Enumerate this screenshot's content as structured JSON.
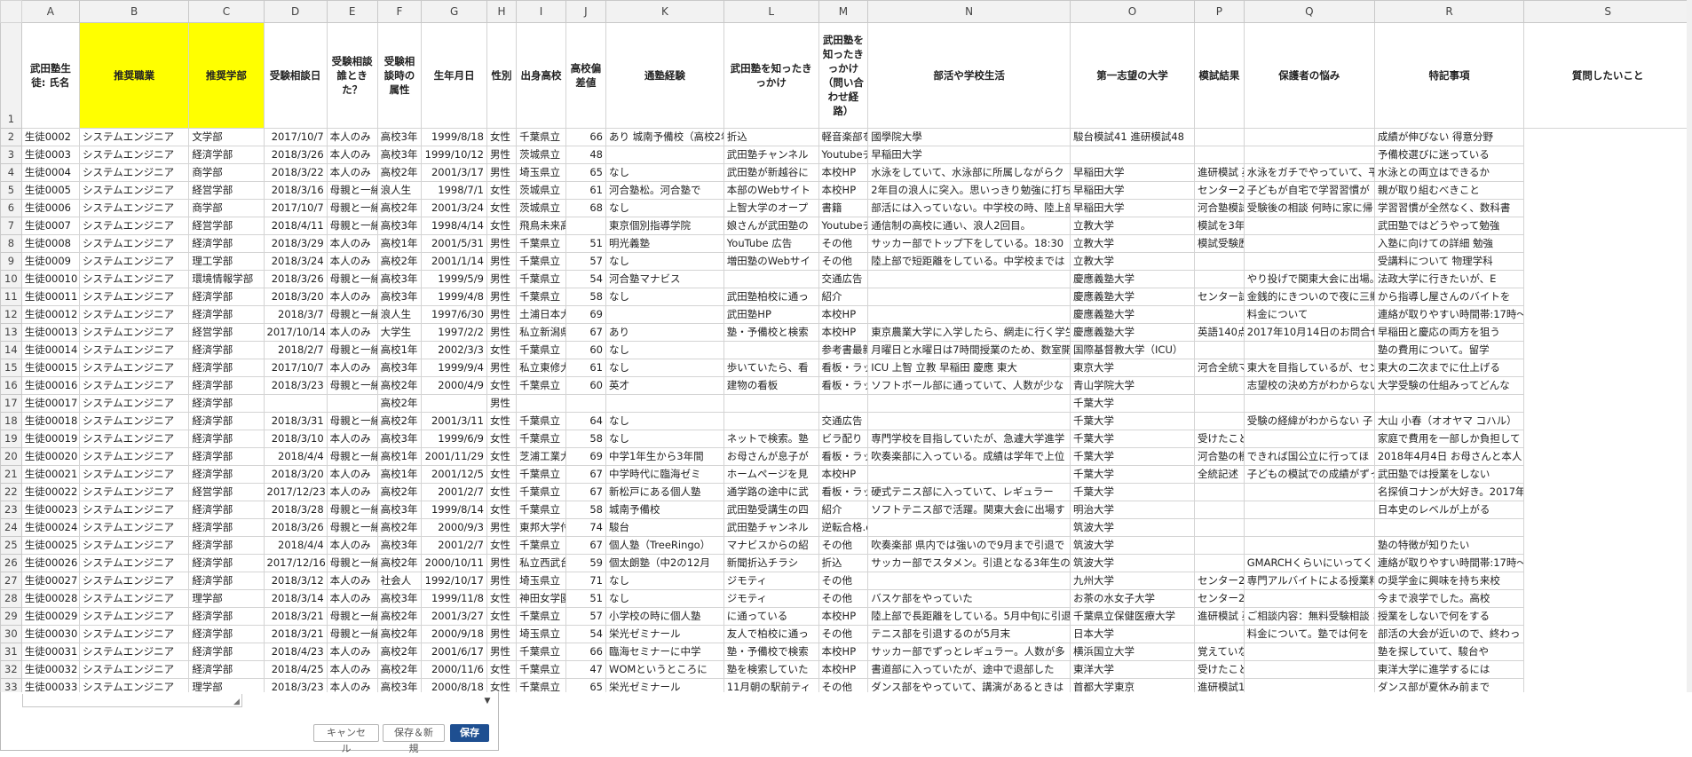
{
  "columns": [
    "A",
    "B",
    "C",
    "D",
    "E",
    "F",
    "G",
    "H",
    "I",
    "J",
    "K",
    "L",
    "M",
    "N",
    "O",
    "P",
    "Q",
    "R",
    "S"
  ],
  "header_row_number": "1",
  "headers": [
    "武田塾生徒: 氏名",
    "推奨職業",
    "推奨学部",
    "受験相談日",
    "受験相談誰ときた？",
    "受験相談時の属性",
    "生年月日",
    "性別",
    "出身高校",
    "高校偏差値",
    "通塾経験",
    "武田塾を知ったきっかけ",
    "武田塾を知ったきっかけ（問い合わせ経路）",
    "部活や学校生活",
    "第一志望の大学",
    "模試結果",
    "保護者の悩み",
    "特記事項",
    "質問したいこと"
  ],
  "rows": [
    [
      "2",
      "生徒0002",
      "システムエンジニア",
      "文学部",
      "2017/10/7",
      "本人のみ",
      "高校3年",
      "1999/8/18",
      "女性",
      "千葉県立",
      "66",
      "あり 城南予備校（高校2年夏から。集団",
      "折込",
      "軽音楽部をやっていて、ドラムをしている",
      "國學院大學",
      "駿台模試41 進研模試48",
      "",
      "",
      "成績が伸びない 得意分野"
    ],
    [
      "3",
      "生徒0003",
      "システムエンジニア",
      "経済学部",
      "2018/3/26",
      "本人のみ",
      "高校3年",
      "1999/10/12",
      "男性",
      "茨城県立",
      "48",
      "",
      "武田塾チャンネル",
      "Youtubeチャンネル",
      "早稲田大学",
      "",
      "",
      "",
      "予備校選びに迷っている"
    ],
    [
      "4",
      "生徒0004",
      "システムエンジニア",
      "商学部",
      "2018/3/22",
      "本人のみ",
      "高校2年",
      "2001/3/17",
      "男性",
      "埼玉県立",
      "65",
      "なし",
      "武田塾が新越谷に",
      "本校HP",
      "水泳をしていて、水泳部に所属しながらク",
      "早稲田大学",
      "進研模試 英語56 数学50 国語48 日本史",
      "水泳をガチでやっていて、平日",
      "水泳との両立はできるか"
    ],
    [
      "5",
      "生徒0005",
      "システムエンジニア",
      "経営学部",
      "2018/3/16",
      "母親と一緒",
      "浪人生",
      "1998/7/1",
      "女性",
      "茨城県立",
      "61",
      "河合塾松。河合塾で",
      "本部のWebサイト",
      "本校HP",
      "2年目の浪人に突入。思いっきり勉強に打ち",
      "早稲田大学",
      "センター2",
      "子どもが自宅で学習習慣が",
      "親が取り組むべきこと"
    ],
    [
      "6",
      "生徒0006",
      "システムエンジニア",
      "商学部",
      "2017/10/7",
      "母親と一緒",
      "高校2年",
      "2001/3/24",
      "女性",
      "茨城県立",
      "68",
      "なし",
      "上智大学のオープ",
      "書籍",
      "部活には入っていない。中学校の時、陸上部",
      "早稲田大学",
      "河合塾模試",
      "受験後の相談 何時に家に帰",
      "学習習慣が全然なく、数科書"
    ],
    [
      "7",
      "生徒0007",
      "システムエンジニア",
      "経営学部",
      "2018/4/11",
      "母親と一緒",
      "高校3年",
      "1998/4/14",
      "女性",
      "飛鳥未来高等学校",
      "",
      "東京個別指導学院",
      "娘さんが武田塾の",
      "Youtubeチャンネル",
      "通信制の高校に通い、浪人2回目。",
      "立教大学",
      "模試を3年間受けていない",
      "",
      "武田塾ではどうやって勉強"
    ],
    [
      "8",
      "生徒0008",
      "システムエンジニア",
      "経済学部",
      "2018/3/29",
      "本人のみ",
      "高校1年",
      "2001/5/31",
      "男性",
      "千葉県立",
      "51",
      "明光義塾",
      "YouTube 広告",
      "その他",
      "サッカー部でトップ下をしている。18:30",
      "立教大学",
      "模試受験歴なし",
      "",
      "入塾に向けての詳細 勉強"
    ],
    [
      "9",
      "生徒0009",
      "システムエンジニア",
      "理工学部",
      "2018/3/24",
      "本人のみ",
      "高校2年",
      "2001/1/14",
      "男性",
      "千葉県立",
      "57",
      "なし",
      "増田塾のWebサイ",
      "その他",
      "陸上部で短距離をしている。中学校までは",
      "立教大学",
      "",
      "",
      "受講料について 物理学科"
    ],
    [
      "10",
      "生徒00010",
      "システムエンジニア",
      "環境情報学部",
      "2018/3/26",
      "母親と一緒",
      "高校3年",
      "1999/5/9",
      "男性",
      "千葉県立",
      "54",
      "河合塾マナビス",
      "",
      "交通広告（駅看板・中吊り等）",
      "",
      "慶應義塾大学",
      "",
      "やり投げで関東大会に出場。大",
      "法政大学に行きたいが、E"
    ],
    [
      "11",
      "生徒00011",
      "システムエンジニア",
      "経済学部",
      "2018/3/20",
      "本人のみ",
      "高校3年",
      "1999/4/8",
      "男性",
      "千葉県立",
      "58",
      "なし",
      "武田塾柏校に通っ",
      "紹介",
      "",
      "慶應義塾大学",
      "センター試験2018 英語140 現代文64",
      "金銭的にきついので夜に三郷で",
      "から指導し屋さんのバイトを"
    ],
    [
      "12",
      "生徒00012",
      "システムエンジニア",
      "経済学部",
      "2018/3/7",
      "母親と一緒",
      "浪人生",
      "1997/6/30",
      "男性",
      "土浦日本大",
      "69",
      "",
      "武田塾HP",
      "本校HP",
      "",
      "慶應義塾大学",
      "",
      "料金について",
      "連絡が取りやすい時間帯:17時〜"
    ],
    [
      "13",
      "生徒00013",
      "システムエンジニア",
      "経営学部",
      "2017/10/14",
      "本人のみ",
      "大学生",
      "1997/2/2",
      "男性",
      "私立新潟県",
      "67",
      "あり",
      "塾・予備校と検索",
      "本校HP",
      "東京農業大学に入学したら、網走に行く学生",
      "慶應義塾大学",
      "英語140点 国語160点 政経50点 数学1",
      "2017年10月14日のお問合せ時点",
      "早稲田と慶応の両方を狙う"
    ],
    [
      "14",
      "生徒00014",
      "システムエンジニア",
      "経済学部",
      "2018/2/7",
      "母親と一緒",
      "高校1年",
      "2002/3/3",
      "女性",
      "千葉県立",
      "60",
      "なし",
      "",
      "参考書最新",
      "月曜日と水曜日は7時間授業のため、数室開",
      "国際基督教大学（ICU）",
      "",
      "",
      "塾の費用について。留学"
    ],
    [
      "15",
      "生徒00015",
      "システムエンジニア",
      "経済学部",
      "2017/10/7",
      "本人のみ",
      "高校3年",
      "1999/9/4",
      "男性",
      "私立東修大",
      "61",
      "なし",
      "歩いていたら、看",
      "看板・ラッ",
      "ICU 上智 立教 早稲田 慶應 東大",
      "東京大学",
      "河合全統マーク模試 英語 170 リスニン",
      "東大を目指しているが、センタ",
      "東大の二次までに仕上げる"
    ],
    [
      "16",
      "生徒00016",
      "システムエンジニア",
      "経済学部",
      "2018/3/23",
      "母親と一緒",
      "高校2年",
      "2000/4/9",
      "女性",
      "千葉県立",
      "60",
      "英才",
      "建物の看板",
      "看板・ラッ",
      "ソフトボール部に通っていて、人数が少な",
      "青山学院大学",
      "",
      "志望校の決め方がわからない",
      "大学受験の仕組みってどんな"
    ],
    [
      "17",
      "生徒00017",
      "システムエンジニア",
      "経済学部",
      "",
      "",
      "高校2年",
      "",
      "男性",
      "",
      "",
      "",
      "",
      "",
      "",
      "千葉大学",
      "",
      "",
      ""
    ],
    [
      "18",
      "生徒00018",
      "システムエンジニア",
      "経済学部",
      "2018/3/31",
      "母親と一緒",
      "高校2年",
      "2001/3/11",
      "女性",
      "千葉県立",
      "64",
      "なし",
      "",
      "交通広告（駅看板・中吊り等）",
      "",
      "千葉大学",
      "",
      "受験の経緯がわからない 子",
      "大山 小春（オオヤマ コハル）"
    ],
    [
      "19",
      "生徒00019",
      "システムエンジニア",
      "経済学部",
      "2018/3/10",
      "本人のみ",
      "高校3年",
      "1999/6/9",
      "女性",
      "千葉県立",
      "58",
      "なし",
      "ネットで検索。塾",
      "ビラ配り",
      "専門学校を目指していたが、急遽大学進学",
      "千葉大学",
      "受けたことがない",
      "",
      "家庭で費用を一部しか負担して"
    ],
    [
      "20",
      "生徒00020",
      "システムエンジニア",
      "経済学部",
      "2018/4/4",
      "母親と一緒",
      "高校1年",
      "2001/11/29",
      "女性",
      "芝浦工業大",
      "69",
      "中学1年生から3年間",
      "お母さんが息子が",
      "看板・ラッ",
      "吹奏楽部に入っている。成績は学年で上位",
      "千葉大学",
      "河合塾の模",
      "できれば国公立に行ってほ",
      "2018年4月4日 お母さんと本人"
    ],
    [
      "21",
      "生徒00021",
      "システムエンジニア",
      "経済学部",
      "2018/3/20",
      "本人のみ",
      "高校1年",
      "2001/12/5",
      "女性",
      "千葉県立",
      "67",
      "中学時代に臨海ゼミ",
      "ホームページを見",
      "本校HP",
      "",
      "千葉大学",
      "全統記述",
      "子どもの模試での成績がずっと下がり続けているのでどうし",
      "武田塾では授業をしない"
    ],
    [
      "22",
      "生徒00022",
      "システムエンジニア",
      "経営学部",
      "2017/12/23",
      "本人のみ",
      "高校2年",
      "2001/2/7",
      "女性",
      "千葉県立",
      "67",
      "新松戸にある個人塾",
      "通学路の途中に武",
      "看板・ラッ",
      "硬式テニス部に入っていて、レギュラー",
      "千葉大学",
      "",
      "",
      "名探偵コナンが大好き。2017年"
    ],
    [
      "23",
      "生徒00023",
      "システムエンジニア",
      "経済学部",
      "2018/3/28",
      "母親と一緒",
      "高校3年",
      "1999/8/14",
      "女性",
      "千葉県立",
      "58",
      "城南予備校",
      "武田塾受講生の四",
      "紹介",
      "ソフトテニス部で活躍。関東大会に出場す",
      "明治大学",
      "",
      "",
      "日本史のレベルが上がる"
    ],
    [
      "24",
      "生徒00024",
      "システムエンジニア",
      "経済学部",
      "2018/3/26",
      "母親と一緒",
      "高校2年",
      "2000/9/3",
      "男性",
      "東邦大学付",
      "74",
      "駿台",
      "武田塾チャンネル",
      "逆転合格.com",
      "",
      "筑波大学",
      "",
      "",
      ""
    ],
    [
      "25",
      "生徒00025",
      "システムエンジニア",
      "経済学部",
      "2018/4/4",
      "本人のみ",
      "高校3年",
      "2001/2/7",
      "女性",
      "千葉県立",
      "67",
      "個人塾（TreeRingo）",
      "マナビスからの紹",
      "その他",
      "吹奏楽部 県内では強いので9月まで引退で",
      "筑波大学",
      "",
      "",
      "塾の特徴が知りたい"
    ],
    [
      "26",
      "生徒00026",
      "システムエンジニア",
      "経済学部",
      "2017/12/16",
      "母親と一緒",
      "高校2年",
      "2000/10/11",
      "男性",
      "私立西武台",
      "59",
      "個太朗塾（中2の12月",
      "新聞折込チラシ",
      "折込",
      "サッカー部でスタメン。引退となる3年生の",
      "筑波大学",
      "",
      "GMARCHくらいにいってく",
      "連絡が取りやすい時間帯:17時〜"
    ],
    [
      "27",
      "生徒00027",
      "システムエンジニア",
      "経済学部",
      "2018/3/12",
      "本人のみ",
      "社会人",
      "1992/10/17",
      "男性",
      "埼玉県立",
      "71",
      "なし",
      "ジモティ",
      "その他",
      "",
      "九州大学",
      "センター2018 英語：190 数学：90 / 6",
      "専門アルバイトによる授業料",
      "の奨学金に興味を持ち来校"
    ],
    [
      "28",
      "生徒00028",
      "システムエンジニア",
      "理学部",
      "2018/3/14",
      "本人のみ",
      "高校3年",
      "1999/11/8",
      "女性",
      "神田女学園",
      "51",
      "なし",
      "ジモティ",
      "その他",
      "バスケ部をやっていた",
      "お茶の水女子大学",
      "センター2018 英語120 数1A50 数2B50 国語150 社会60 物理40 化学",
      "",
      "今まで浪学でした。高校"
    ],
    [
      "29",
      "生徒00029",
      "システムエンジニア",
      "経済学部",
      "2018/3/21",
      "母親と一緒",
      "高校2年",
      "2001/3/27",
      "女性",
      "千葉県立",
      "57",
      "小学校の時に個人塾",
      "に通っている",
      "本校HP",
      "陸上部で長距離をしている。5月中旬に引退",
      "千葉県立保健医療大学",
      "進研模試 英語52 数学40 国語50 3教科",
      "ご相談内容：無料受験相談 お名",
      "授業をしないで何をする"
    ],
    [
      "30",
      "生徒00030",
      "システムエンジニア",
      "経済学部",
      "2018/3/21",
      "母親と一緒",
      "高校2年",
      "2000/9/18",
      "男性",
      "埼玉県立",
      "54",
      "栄光ゼミナール",
      "友人で柏校に通っ",
      "その他",
      "テニス部を引退するのが5月末",
      "日本大学",
      "",
      "料金について。塾では何を",
      "部活の大会が近いので、終わっ"
    ],
    [
      "31",
      "生徒00031",
      "システムエンジニア",
      "経済学部",
      "2018/4/23",
      "本人のみ",
      "高校2年",
      "2001/6/17",
      "男性",
      "千葉県立",
      "66",
      "臨海セミナーに中学",
      "塾・予備校で検索",
      "本校HP",
      "サッカー部でずっとレギュラー。人数が多",
      "横浜国立大学",
      "覚えていない",
      "",
      "塾を探していて、駿台や"
    ],
    [
      "32",
      "生徒00032",
      "システムエンジニア",
      "経済学部",
      "2018/4/25",
      "本人のみ",
      "高校2年",
      "2000/11/6",
      "女性",
      "千葉県立",
      "47",
      "WOMというところに",
      "塾を検索していた",
      "本校HP",
      "書道部に入っていたが、途中で退部した",
      "東洋大学",
      "受けたことがない 6月に学校で模試を受ける",
      "",
      "東洋大学に進学するには"
    ],
    [
      "33",
      "生徒00033",
      "システムエンジニア",
      "理学部",
      "2018/3/23",
      "本人のみ",
      "高校3年",
      "2000/8/18",
      "女性",
      "千葉県立",
      "65",
      "栄光ゼミナール",
      "11月朝の駅前ティ",
      "その他",
      "ダンス部をやっていて、講演があるときは",
      "首都大学東京",
      "進研模試1月 英語48 / 45.9 国語54 43.9 化学基礎14 45.2 生物基礎14",
      "",
      "ダンス部が夏休み前まで"
    ]
  ],
  "form": {
    "cancel_label": "キャンセル",
    "save_new_label": "保存＆新規",
    "save_label": "保存",
    "resize_grip_icon": "resize-grip-icon",
    "scroll_icon": "chevron-down-icon"
  },
  "colors": {
    "highlight": "#ffff00",
    "primary_button": "#1e4f91"
  }
}
